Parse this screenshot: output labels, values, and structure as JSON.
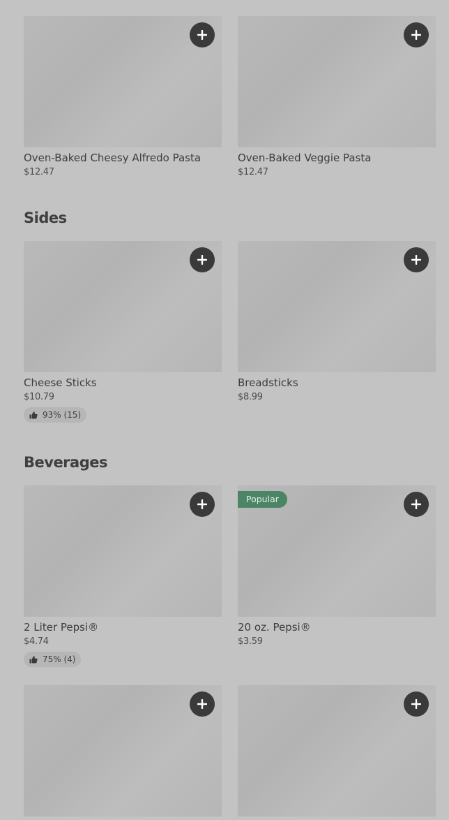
{
  "colors": {
    "background": "#c3c3c3",
    "add_button": "#3a3a3a",
    "popular_badge": "#4b8566"
  },
  "sections": [
    {
      "title": "",
      "items": [
        {
          "name": "Oven-Baked Cheesy Alfredo Pasta",
          "price": "$12.47"
        },
        {
          "name": "Oven-Baked Veggie Pasta",
          "price": "$12.47"
        }
      ]
    },
    {
      "title": "Sides",
      "items": [
        {
          "name": "Cheese Sticks",
          "price": "$10.79",
          "rating": "93% (15)"
        },
        {
          "name": "Breadsticks",
          "price": "$8.99"
        }
      ]
    },
    {
      "title": "Beverages",
      "items": [
        {
          "name": "2 Liter Pepsi®",
          "price": "$4.74",
          "rating": "75% (4)"
        },
        {
          "name": "20 oz. Pepsi®",
          "price": "$3.59",
          "badge": "Popular"
        },
        {
          "name": "",
          "price": ""
        },
        {
          "name": "",
          "price": ""
        }
      ]
    }
  ],
  "icons": {
    "add": "plus-icon",
    "rating": "thumbs-up-icon"
  }
}
